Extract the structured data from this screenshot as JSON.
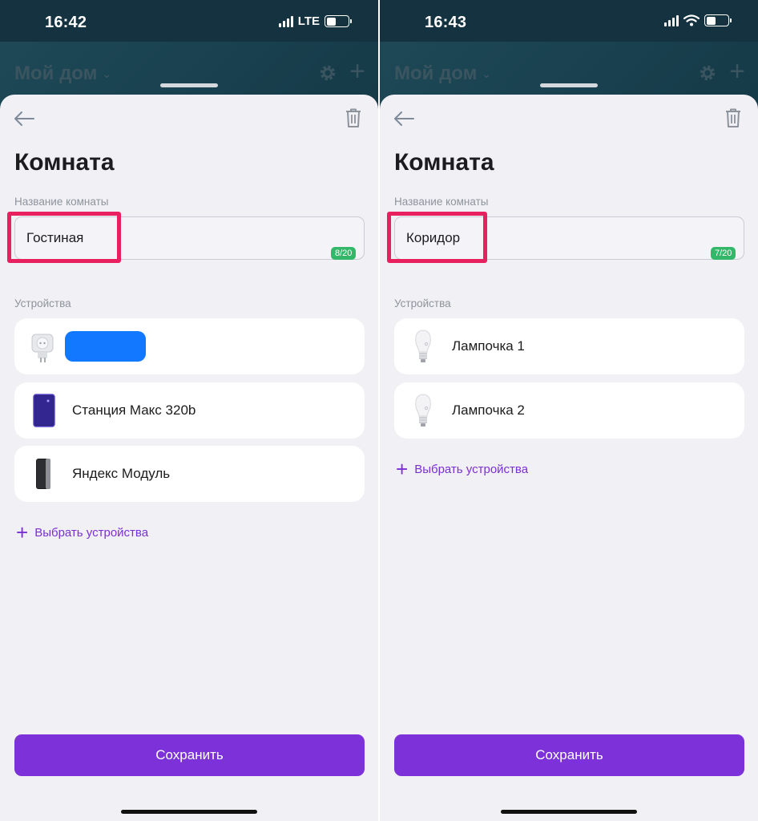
{
  "screens": [
    {
      "status": {
        "time": "16:42",
        "network": "LTE"
      },
      "background": {
        "title": "Мой дом"
      },
      "sheet": {
        "title": "Комната",
        "name_label": "Название комнаты",
        "name_value": "Гостиная",
        "counter": "8/20",
        "devices_label": "Устройства",
        "devices": [
          {
            "name": "",
            "icon": "smart-plug-icon",
            "redacted": true
          },
          {
            "name": "Станция Макс 320b",
            "icon": "speaker-station-icon"
          },
          {
            "name": "Яндекс Модуль",
            "icon": "module-icon"
          }
        ],
        "add_label": "Выбрать устройства",
        "save_label": "Сохранить"
      }
    },
    {
      "status": {
        "time": "16:43",
        "network": "wifi"
      },
      "background": {
        "title": "Мой дом"
      },
      "sheet": {
        "title": "Комната",
        "name_label": "Название комнаты",
        "name_value": "Коридор",
        "counter": "7/20",
        "devices_label": "Устройства",
        "devices": [
          {
            "name": "Лампочка 1",
            "icon": "lightbulb-icon"
          },
          {
            "name": "Лампочка 2",
            "icon": "lightbulb-icon"
          }
        ],
        "add_label": "Выбрать устройства",
        "save_label": "Сохранить"
      }
    }
  ],
  "colors": {
    "accent": "#7c32d8",
    "highlight": "#e8205f",
    "counter": "#33b86a",
    "sheet_bg": "#f1f1f5"
  }
}
